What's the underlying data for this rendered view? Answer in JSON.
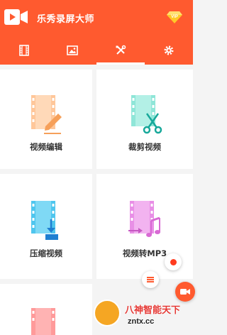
{
  "app": {
    "title": "乐秀录屏大师",
    "vip_label": "VIP"
  },
  "colors": {
    "brand": "#ff5a2f",
    "edit": "#ffd9b8",
    "trim": "#b3f0e6",
    "compress": "#7fd9f5",
    "convert": "#f2b3f0"
  },
  "tabs": [
    {
      "icon": "film-strip-icon",
      "active": false
    },
    {
      "icon": "image-icon",
      "active": false
    },
    {
      "icon": "tools-icon",
      "active": true
    },
    {
      "icon": "gear-icon",
      "active": false
    }
  ],
  "tools": [
    {
      "label": "视频编辑",
      "icon": "video-edit-icon"
    },
    {
      "label": "裁剪视频",
      "icon": "video-trim-icon"
    },
    {
      "label": "压缩视频",
      "icon": "video-compress-icon"
    },
    {
      "label": "视频转MP3",
      "icon": "video-to-mp3-icon"
    }
  ],
  "watermark": {
    "line1": "八神智能天下",
    "line2": "zntx.cc"
  }
}
